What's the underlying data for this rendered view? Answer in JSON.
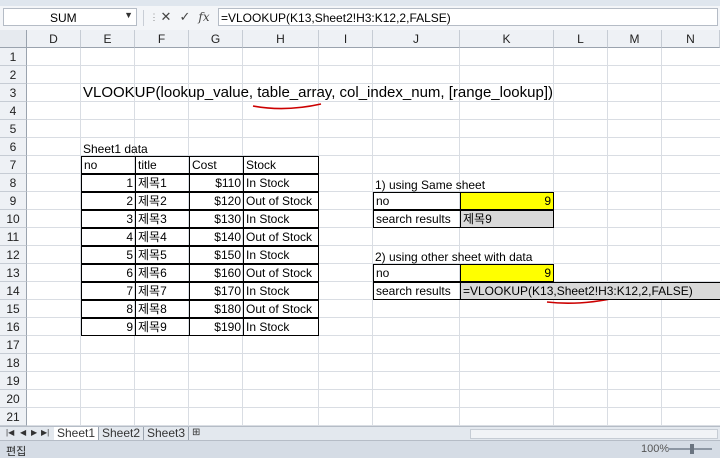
{
  "namebox": {
    "value": "SUM"
  },
  "formula_bar": {
    "cancel_icon": "✕",
    "enter_icon": "✓",
    "fx_label": "fx",
    "formula": "=VLOOKUP(K13,Sheet2!H3:K12,2,FALSE)"
  },
  "columns": [
    "D",
    "E",
    "F",
    "G",
    "H",
    "I",
    "J",
    "K",
    "L",
    "M",
    "N"
  ],
  "rows": [
    "1",
    "2",
    "3",
    "4",
    "5",
    "6",
    "7",
    "8",
    "9",
    "10",
    "11",
    "12",
    "13",
    "14",
    "15",
    "16",
    "17",
    "18",
    "19",
    "20",
    "21"
  ],
  "syntax_text": "VLOOKUP(lookup_value, table_array, col_index_num, [range_lookup])",
  "sheet1": {
    "caption": "Sheet1 data",
    "headers": [
      "no",
      "title",
      "Cost",
      "Stock"
    ],
    "rows": [
      [
        "1",
        "제목1",
        "$110",
        "In Stock"
      ],
      [
        "2",
        "제목2",
        "$120",
        "Out of Stock"
      ],
      [
        "3",
        "제목3",
        "$130",
        "In Stock"
      ],
      [
        "4",
        "제목4",
        "$140",
        "Out of Stock"
      ],
      [
        "5",
        "제목5",
        "$150",
        "In Stock"
      ],
      [
        "6",
        "제목6",
        "$160",
        "Out of Stock"
      ],
      [
        "7",
        "제목7",
        "$170",
        "In Stock"
      ],
      [
        "8",
        "제목8",
        "$180",
        "Out of Stock"
      ],
      [
        "9",
        "제목9",
        "$190",
        "In Stock"
      ]
    ]
  },
  "lookup_same": {
    "caption": "1) using Same sheet",
    "no_label": "no",
    "no_value": "9",
    "result_label": "search results",
    "result_value": "제목9"
  },
  "lookup_other": {
    "caption": "2) using other sheet with data",
    "no_label": "no",
    "no_value": "9",
    "result_label": "search results",
    "result_value": "=VLOOKUP(K13,Sheet2!H3:K12,2,FALSE)"
  },
  "tabs": [
    "Sheet1",
    "Sheet2",
    "Sheet3"
  ],
  "status": {
    "mode": "편집",
    "zoom": "100%"
  },
  "colors": {
    "highlight": "#ffff00",
    "result_bg": "#d9d9d9",
    "annotation": "#cc0000"
  }
}
